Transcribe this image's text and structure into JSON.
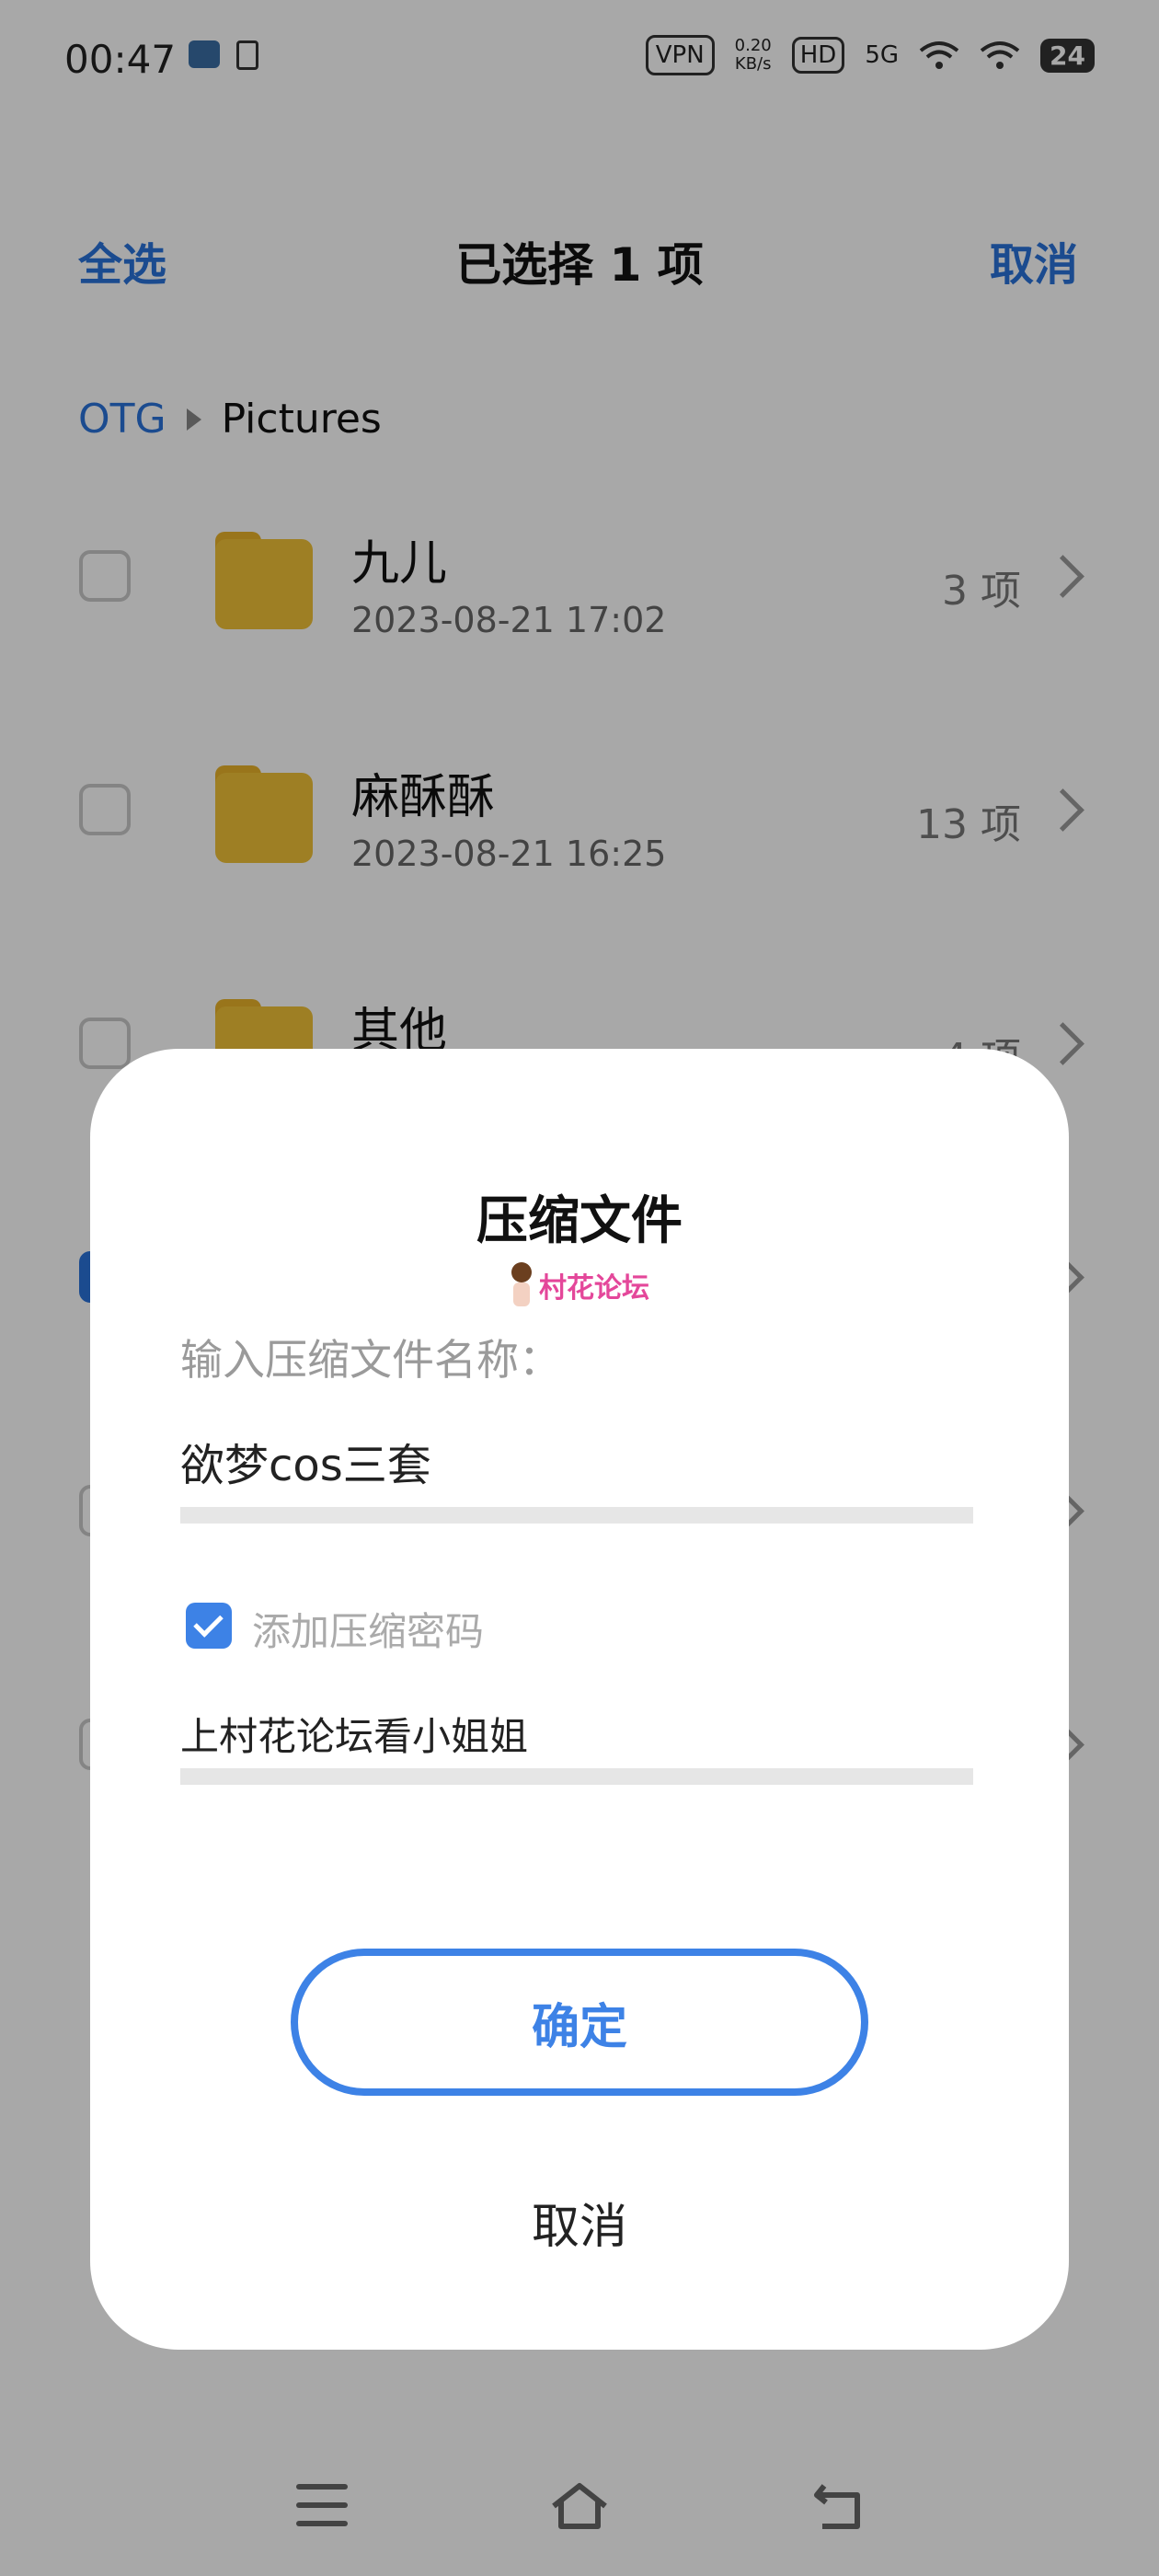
{
  "status_bar": {
    "time": "00:47",
    "vpn": "VPN",
    "speed_value": "0.20",
    "speed_unit": "KB/s",
    "hd": "HD",
    "network": "5G",
    "battery": "24"
  },
  "header": {
    "select_all": "全选",
    "title": "已选择 1 项",
    "cancel": "取消"
  },
  "breadcrumb": {
    "root": "OTG",
    "current": "Pictures"
  },
  "files": [
    {
      "name": "九儿",
      "date": "2023-08-21 17:02",
      "count": "3 项"
    },
    {
      "name": "麻酥酥",
      "date": "2023-08-21 16:25",
      "count": "13 项"
    },
    {
      "name": "其他",
      "date": "",
      "count": "4 项"
    }
  ],
  "dialog": {
    "title": "压缩文件",
    "watermark": "村花论坛",
    "input_label": "输入压缩文件名称：",
    "file_name_value": "欲梦cos三套",
    "add_password_label": "添加压缩密码",
    "password_value": "上村花论坛看小姐姐",
    "confirm": "确定",
    "cancel": "取消"
  },
  "colors": {
    "accent": "#2a72d9",
    "button_blue": "#3d82e6",
    "folder": "#f0c138"
  }
}
